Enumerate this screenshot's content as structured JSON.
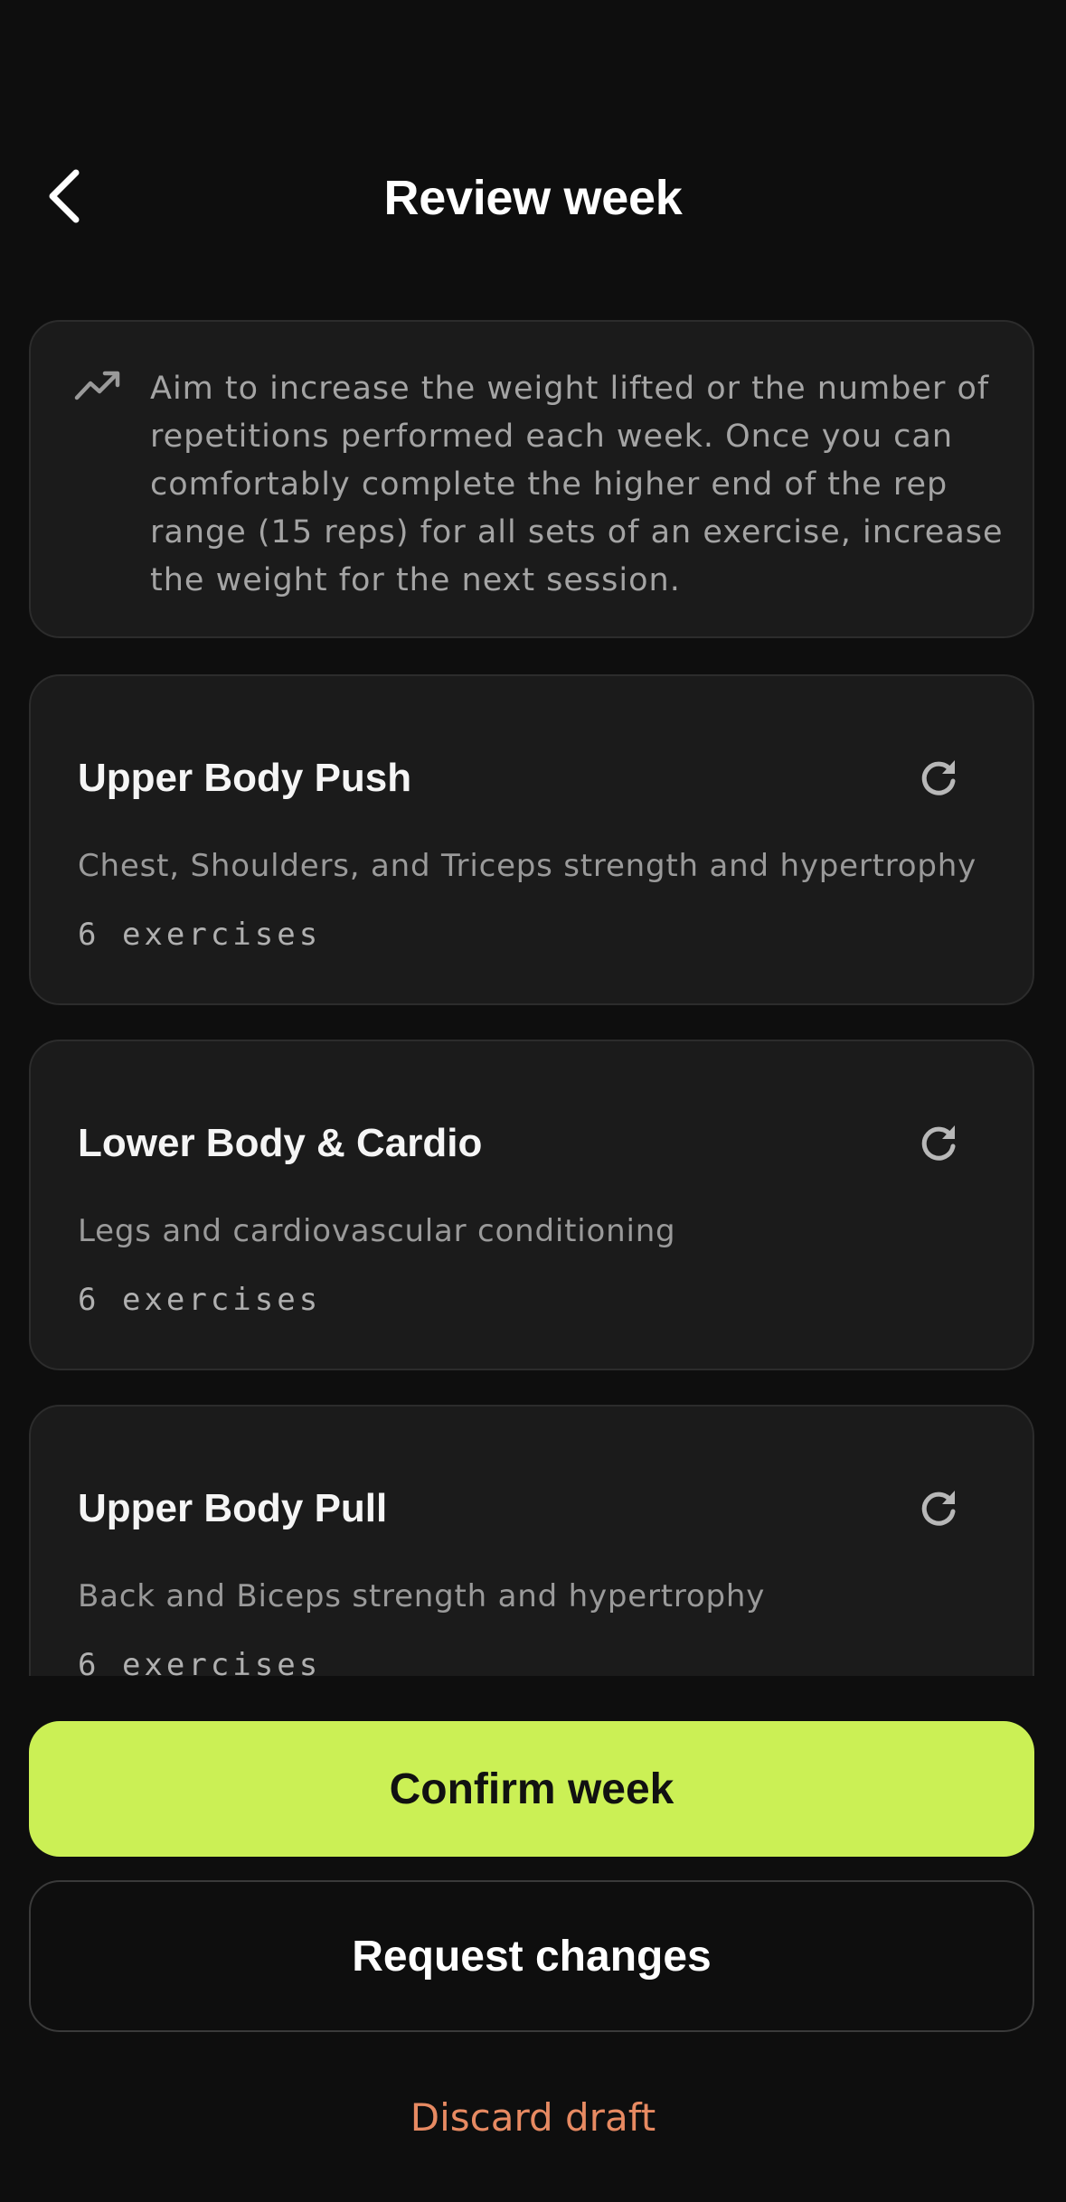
{
  "header": {
    "title": "Review week",
    "back_icon": "chevron-left-icon"
  },
  "tip": {
    "icon": "trending-up-icon",
    "text": "Aim to increase the weight lifted or the number of repetitions performed each week. Once you can comfortably complete the higher end of the rep range (15 reps) for all sets of an exercise, increase the weight for the next session."
  },
  "workouts": [
    {
      "title": "Upper Body Push",
      "description": "Chest, Shoulders, and Triceps strength and hypertrophy",
      "count": "6 exercises",
      "action_icon": "refresh-icon"
    },
    {
      "title": "Lower Body & Cardio",
      "description": "Legs and cardiovascular conditioning",
      "count": "6 exercises",
      "action_icon": "refresh-icon"
    },
    {
      "title": "Upper Body Pull",
      "description": "Back and Biceps strength and hypertrophy",
      "count": "6 exercises",
      "action_icon": "refresh-icon"
    }
  ],
  "actions": {
    "confirm_label": "Confirm week",
    "request_label": "Request changes",
    "discard_label": "Discard draft"
  },
  "colors": {
    "background": "#0e0e0e",
    "card": "#1b1b1b",
    "accent": "#cbf055",
    "discard": "#e78a62",
    "muted_text": "#9a9a9a"
  }
}
